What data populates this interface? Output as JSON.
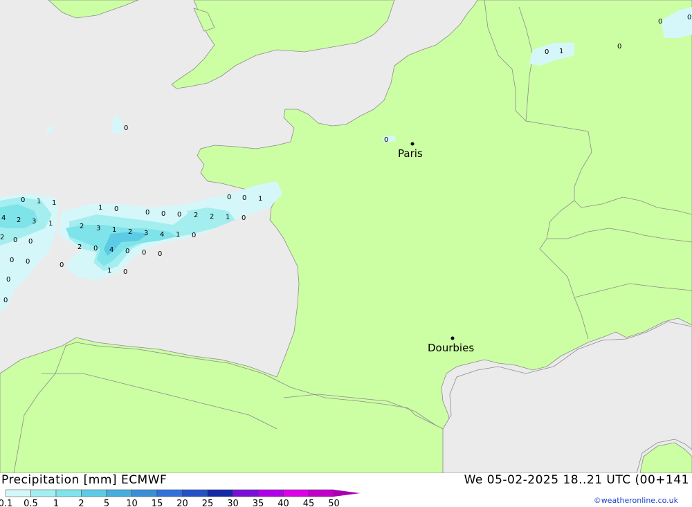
{
  "footer": {
    "title": "Precipitation [mm] ECMWF",
    "datetime": "We 05-02-2025 18..21 UTC (00+141",
    "credit": "©weatheronline.co.uk"
  },
  "legend": {
    "ticks": [
      "0.1",
      "0.5",
      "1",
      "2",
      "5",
      "10",
      "15",
      "20",
      "25",
      "30",
      "35",
      "40",
      "45",
      "50"
    ],
    "colors": [
      "#d6f7f9",
      "#a4eef0",
      "#7fe3ea",
      "#5ccbe6",
      "#45aedd",
      "#3a8fd6",
      "#3070dc",
      "#2450c8",
      "#1428a8",
      "#7a10d8",
      "#b000e8",
      "#dc00e8",
      "#c000c8",
      "#a800b0"
    ]
  },
  "colors": {
    "sea": "#ebebeb",
    "land": "#ccfea4",
    "border": "#8c8c8c"
  },
  "places": [
    {
      "name": "Paris"
    },
    {
      "name": "Dourbies"
    }
  ],
  "values": [
    "0",
    "1",
    "1",
    "4",
    "2",
    "3",
    "1",
    "2",
    "0",
    "0",
    "1",
    "0",
    "0",
    "0",
    "0",
    "0",
    "0",
    "0",
    "0",
    "2",
    "3",
    "1",
    "2",
    "3",
    "4",
    "1",
    "0",
    "2",
    "0",
    "4",
    "0",
    "0",
    "0",
    "1",
    "0",
    "0",
    "0",
    "2",
    "2",
    "1",
    "0",
    "0",
    "0",
    "1",
    "0",
    "0",
    "1",
    "0",
    "0",
    "0"
  ]
}
